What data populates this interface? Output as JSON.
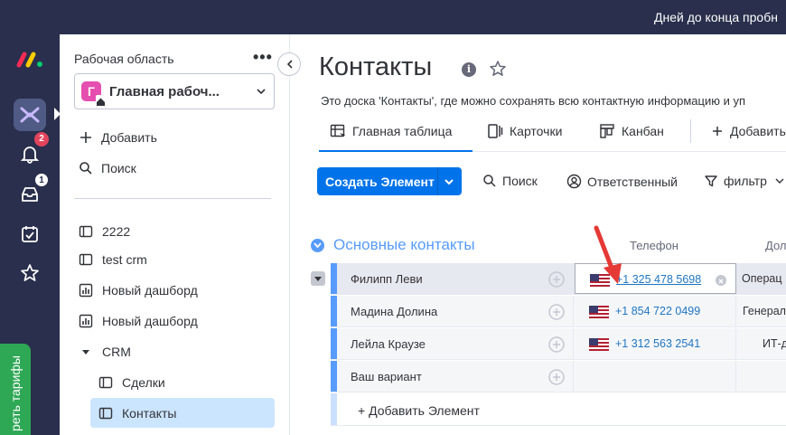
{
  "topbar": {
    "trial_text": "Дней до конца пробн"
  },
  "rail": {
    "notifications_badge": "2",
    "inbox_badge": "1",
    "plans_label": "реть тарифы"
  },
  "workspace": {
    "label": "Рабочая область",
    "more": "•••",
    "avatar_letter": "Г",
    "name": "Главная рабоч...",
    "add_label": "Добавить",
    "search_label": "Поиск",
    "boards": [
      {
        "label": "2222",
        "icon": "board-icon"
      },
      {
        "label": "test crm",
        "icon": "board-icon"
      },
      {
        "label": "Новый дашборд",
        "icon": "dashboard-icon"
      },
      {
        "label": "Новый дашборд",
        "icon": "dashboard-icon"
      }
    ],
    "folder": {
      "label": "CRM",
      "items": [
        "Сделки",
        "Контакты"
      ],
      "active": "Контакты"
    }
  },
  "board": {
    "title": "Контакты",
    "info_glyph": "i",
    "description": "Это доска 'Контакты', где можно сохранять всю контактную информацию и уп",
    "tabs": [
      {
        "label": "Главная таблица",
        "icon": "table-icon",
        "active": true
      },
      {
        "label": "Карточки",
        "icon": "cards-icon"
      },
      {
        "label": "Канбан",
        "icon": "kanban-icon"
      },
      {
        "label": "Добавить",
        "icon": "plus-icon"
      }
    ],
    "toolbar": {
      "create_label": "Создать Элемент",
      "search_label": "Поиск",
      "person_label": "Ответственный",
      "filter_label": "фильтр"
    },
    "group": {
      "title": "Основные контакты",
      "color": "#579bfc",
      "columns": [
        "Телефон",
        "Дол"
      ],
      "rows": [
        {
          "name": "Филипп Леви",
          "phone": "+1 325 478 5698",
          "position": "Операц"
        },
        {
          "name": "Мадина Долина",
          "phone": "+1 854 722 0499",
          "position": "Генерал"
        },
        {
          "name": "Лейла Краузе",
          "phone": "+1 312 563 2541",
          "position": "ИТ-д"
        },
        {
          "name": "Ваш вариант",
          "phone": "",
          "position": ""
        }
      ],
      "add_item_label": "+ Добавить Элемент"
    }
  },
  "colors": {
    "accent": "#0073ea",
    "rail": "#292f4c",
    "annotation_arrow": "#e53935",
    "plans": "#2fa856"
  }
}
